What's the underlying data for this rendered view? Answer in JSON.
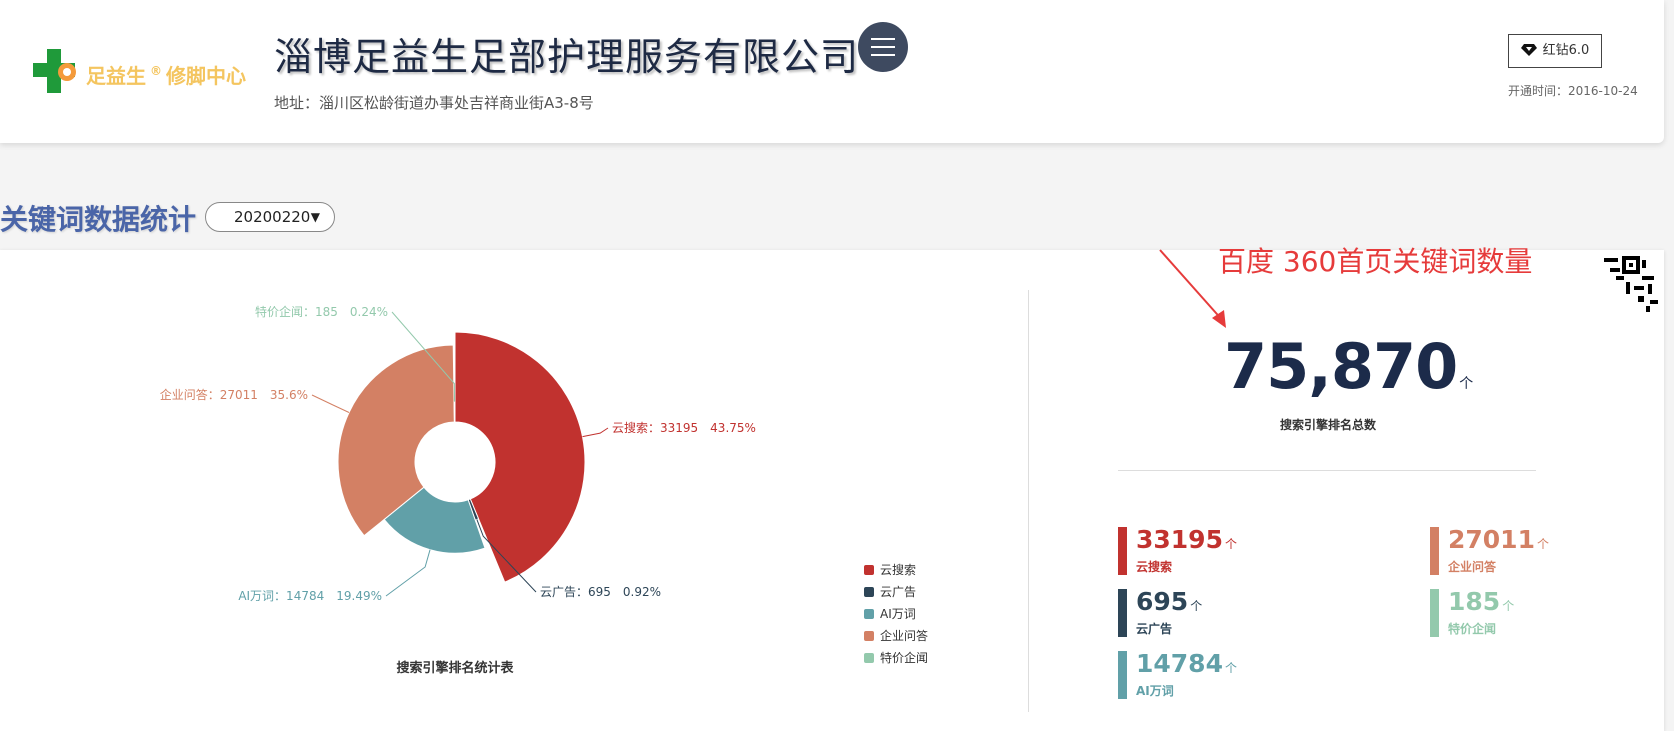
{
  "header": {
    "logo_text": "足益生",
    "logo_reg": "®",
    "logo_sub": "修脚中心",
    "company_name": "淄博足益生足部护理服务有限公司",
    "address": "地址：淄川区松龄街道办事处吉祥商业街A3-8号",
    "vip_label": "红钻6.0",
    "open_date": "开通时间：2016-10-24"
  },
  "section": {
    "title": "关键词数据统计",
    "date_value": "20200220"
  },
  "annotation": "百度 360首页关键词数量",
  "summary": {
    "total": "75,870",
    "unit": "个",
    "total_label": "搜索引擎排名总数"
  },
  "stats": [
    {
      "value": "33195",
      "unit": "个",
      "label": "云搜索",
      "color": "#c1322f"
    },
    {
      "value": "27011",
      "unit": "个",
      "label": "企业问答",
      "color": "#d38064"
    },
    {
      "value": "695",
      "unit": "个",
      "label": "云广告",
      "color": "#2d4557"
    },
    {
      "value": "185",
      "unit": "个",
      "label": "特价企闻",
      "color": "#93c9ac"
    },
    {
      "value": "14784",
      "unit": "个",
      "label": "AI万词",
      "color": "#61a0a8"
    }
  ],
  "chart_data": {
    "type": "pie",
    "title": "搜索引擎排名统计表",
    "legend_position": "bottom-right",
    "slices": [
      {
        "name": "云搜索",
        "value": 33195,
        "percent": "43.75%",
        "color": "#c1322f",
        "label": "云搜索：33195　43.75%"
      },
      {
        "name": "云广告",
        "value": 695,
        "percent": "0.92%",
        "color": "#2d4557",
        "label": "云广告：695　0.92%"
      },
      {
        "name": "AI万词",
        "value": 14784,
        "percent": "19.49%",
        "color": "#61a0a8",
        "label": "AI万词：14784　19.49%"
      },
      {
        "name": "企业问答",
        "value": 27011,
        "percent": "35.6%",
        "color": "#d38064",
        "label": "企业问答：27011　35.6%"
      },
      {
        "name": "特价企闻",
        "value": 185,
        "percent": "0.24%",
        "color": "#93c9ac",
        "label": "特价企闻：185　0.24%"
      }
    ]
  }
}
